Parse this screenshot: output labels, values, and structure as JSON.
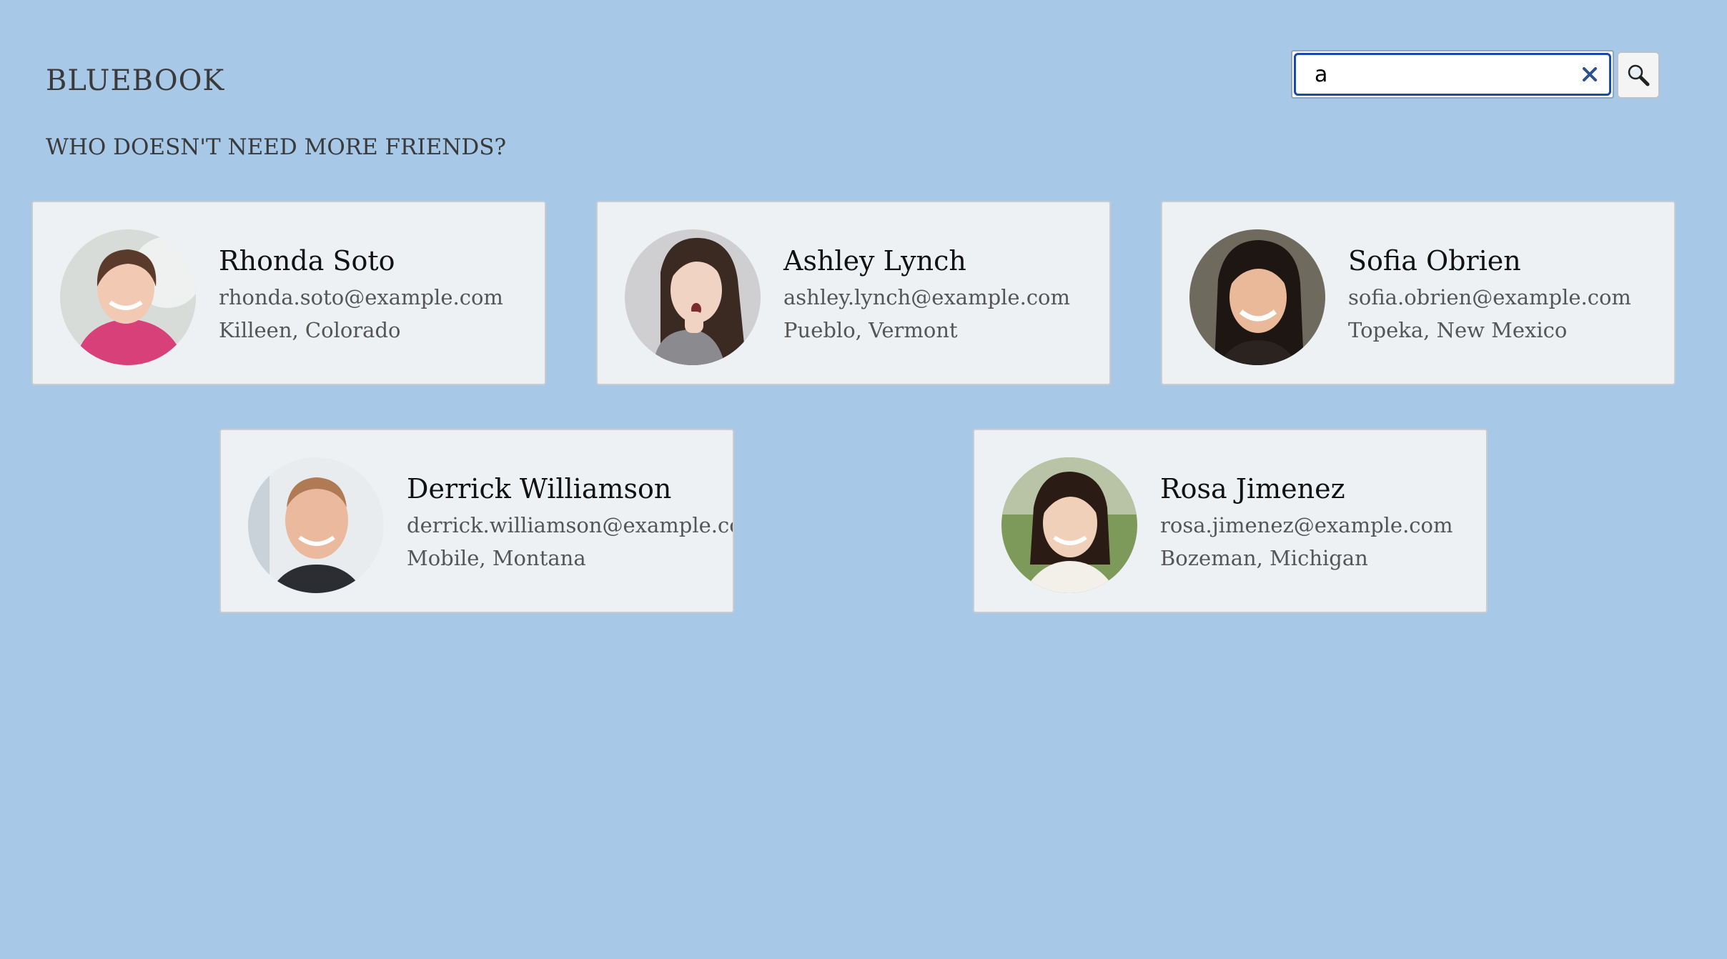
{
  "app": {
    "title": "BLUEBOOK",
    "tagline": "WHO DOESN'T NEED MORE FRIENDS?"
  },
  "search": {
    "value": "a",
    "clear_icon": "close-icon",
    "button_icon": "magnifier-icon"
  },
  "friends": [
    {
      "name": "Rhonda Soto",
      "email": "rhonda.soto@example.com",
      "location": "Killeen, Colorado"
    },
    {
      "name": "Ashley Lynch",
      "email": "ashley.lynch@example.com",
      "location": "Pueblo, Vermont"
    },
    {
      "name": "Sofia Obrien",
      "email": "sofia.obrien@example.com",
      "location": "Topeka, New Mexico"
    },
    {
      "name": "Derrick Williamson",
      "email": "derrick.williamson@example.com",
      "location": "Mobile, Montana"
    },
    {
      "name": "Rosa Jimenez",
      "email": "rosa.jimenez@example.com",
      "location": "Bozeman, Michigan"
    }
  ],
  "colors": {
    "background": "#a8c8e8",
    "card": "#eef1f4",
    "focus_ring": "#1b4aa8"
  }
}
